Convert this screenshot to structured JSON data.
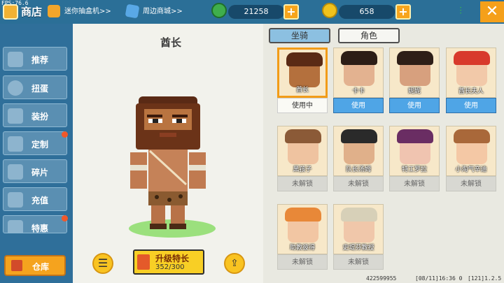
{
  "fps": "FPS:76.6",
  "header": {
    "title": "商店",
    "link1": "迷你抽盒机>>",
    "link2": "周边商城>>",
    "coins": "21258",
    "beans": "658"
  },
  "sidebar": {
    "items": [
      {
        "label": "推荐",
        "badge": false
      },
      {
        "label": "扭蛋",
        "badge": false
      },
      {
        "label": "装扮",
        "badge": false
      },
      {
        "label": "定制",
        "badge": true
      },
      {
        "label": "碎片",
        "badge": false
      },
      {
        "label": "充值",
        "badge": false
      },
      {
        "label": "特惠",
        "badge": true
      }
    ],
    "depot_label": "仓库"
  },
  "preview": {
    "name": "酋长",
    "upgrade_label": "升级特长",
    "upgrade_progress": "352/300"
  },
  "tabs": [
    "坐骑",
    "角色"
  ],
  "characters": [
    {
      "name": "酋长",
      "status": "使用中",
      "state": "inuse",
      "face": "#b4703d",
      "hair": "#5a2a15"
    },
    {
      "name": "卡卡",
      "status": "使用",
      "state": "use",
      "face": "#e3b290",
      "hair": "#2c1d16"
    },
    {
      "name": "妮妮",
      "status": "使用",
      "state": "use",
      "face": "#d7a07e",
      "hair": "#2e1e17"
    },
    {
      "name": "酋长夫人",
      "status": "使用",
      "state": "use",
      "face": "#f2c9a9",
      "hair": "#d83a2c"
    },
    {
      "name": "黑孩子",
      "status": "未解锁",
      "state": "locked",
      "face": "#efc3a0",
      "hair": "#8b5a37"
    },
    {
      "name": "队长汤姆",
      "status": "未解锁",
      "state": "locked",
      "face": "#e0b08a",
      "hair": "#2a2a2a"
    },
    {
      "name": "特工罗拉",
      "status": "未解锁",
      "state": "locked",
      "face": "#f0c4b0",
      "hair": "#6a2d63"
    },
    {
      "name": "小淘气辛迪",
      "status": "未解锁",
      "state": "locked",
      "face": "#f4c8a5",
      "hair": "#a9683a"
    },
    {
      "name": "助教彼得",
      "status": "未解锁",
      "state": "locked",
      "face": "#f2c6a3",
      "hair": "#e88838"
    },
    {
      "name": "史堤芬教授",
      "status": "未解锁",
      "state": "locked",
      "face": "#f0c7aa",
      "hair": "#d7d0b8"
    }
  ],
  "footer": {
    "uid": "422599955",
    "time": "[08/11]16:36 0",
    "version": "[121]1.2.5"
  },
  "colors": {
    "header_bg": "#2b6f97",
    "accent_orange": "#f5a01a",
    "use_blue": "#4fa5e6"
  }
}
